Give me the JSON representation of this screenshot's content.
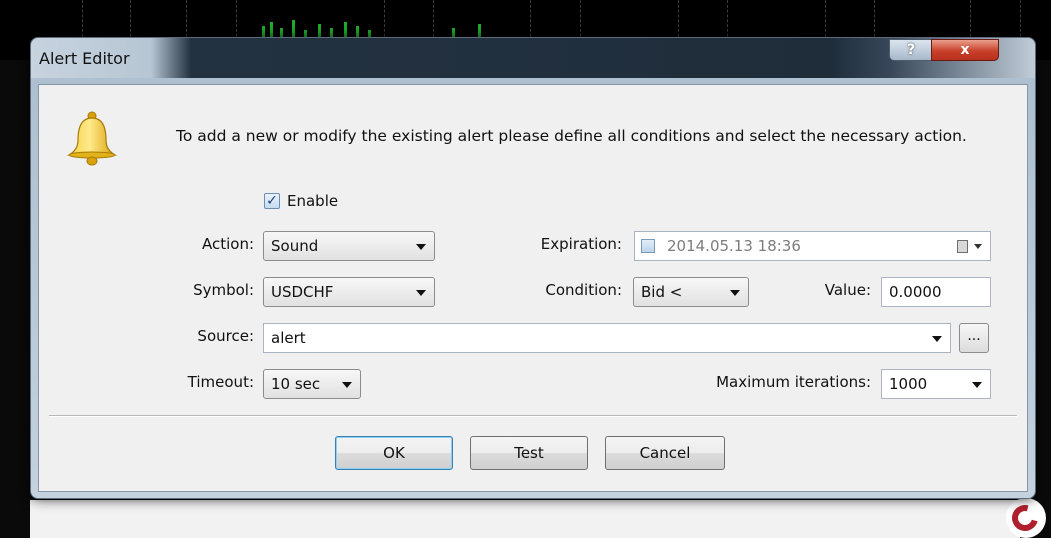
{
  "window": {
    "title": "Alert Editor",
    "help_button": "?",
    "close_button": "x"
  },
  "intro_text": "To add a new or modify the existing alert please define all conditions and select the necessary action.",
  "enable": {
    "label": "Enable",
    "checked": true
  },
  "action": {
    "label": "Action:",
    "value": "Sound"
  },
  "symbol": {
    "label": "Symbol:",
    "value": "USDCHF"
  },
  "source": {
    "label": "Source:",
    "value": "alert",
    "browse_label": "..."
  },
  "timeout": {
    "label": "Timeout:",
    "value": "10 sec"
  },
  "expiration": {
    "label": "Expiration:",
    "value": "2014.05.13 18:36",
    "enabled": false
  },
  "condition": {
    "label": "Condition:",
    "value": "Bid <"
  },
  "value_field": {
    "label": "Value:",
    "value": "0.0000"
  },
  "max_iterations": {
    "label": "Maximum iterations:",
    "value": "1000"
  },
  "buttons": {
    "ok": "OK",
    "test": "Test",
    "cancel": "Cancel"
  },
  "colors": {
    "titlebar_dark": "#1f2d3b",
    "client_bg": "#f0f0f0",
    "bell": "#f2c21a",
    "close_red": "#c8412a"
  }
}
